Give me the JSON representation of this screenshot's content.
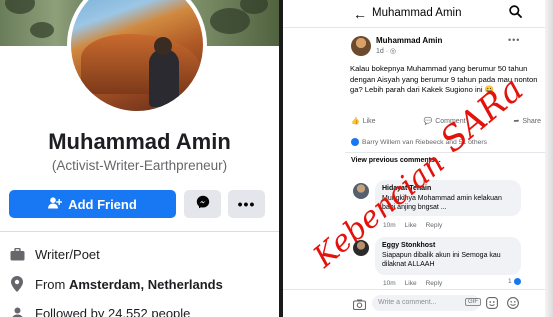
{
  "profile": {
    "name": "Muhammad Amin",
    "bio": "(Activist-Writer-Earthpreneur)",
    "add_friend_label": "Add Friend",
    "more_label": "•••",
    "work": "Writer/Poet",
    "from_prefix": "From ",
    "from_place": "Amsterdam, Netherlands",
    "followed_by": "Followed by 24,552 people",
    "accent_color": "#1877f2"
  },
  "post_view": {
    "back_icon": "arrow-left-icon",
    "title": "Muhammad Amin",
    "post": {
      "author": "Muhammad Amin",
      "time": "1d · ",
      "text": "Kalau bokepnya Muhammad yang berumur 50 tahun dengan Aisyah yang berumur 9 tahun pada mau nonton ga? Lebih parah dari Kakek Sugiono ini 😀",
      "like_label": "Like",
      "comment_label": "Comment",
      "share_label": "Share",
      "reactions_text": "Barry Willem van Riebeeck and 51 others"
    },
    "view_previous": "View previous comments...",
    "comments": [
      {
        "author": "Hidayat Tenain",
        "text": "Mungkinya Mohammad amin kelakuan babi anjing bngsat ...",
        "time": "10m",
        "like": "Like",
        "reply": "Reply"
      },
      {
        "author": "Eggy Stonkhost",
        "text": "Siapapun dibalik akun ini Semoga kau dilaknat ALLAAH",
        "time": "10m",
        "like": "Like",
        "reply": "Reply",
        "reaction_count": "1"
      }
    ],
    "composer_placeholder": "Write a comment...",
    "gif_label": "GIF"
  },
  "watermark": {
    "part1": "Kebencian",
    "part2": "SARa",
    "color": "#e3120b"
  }
}
